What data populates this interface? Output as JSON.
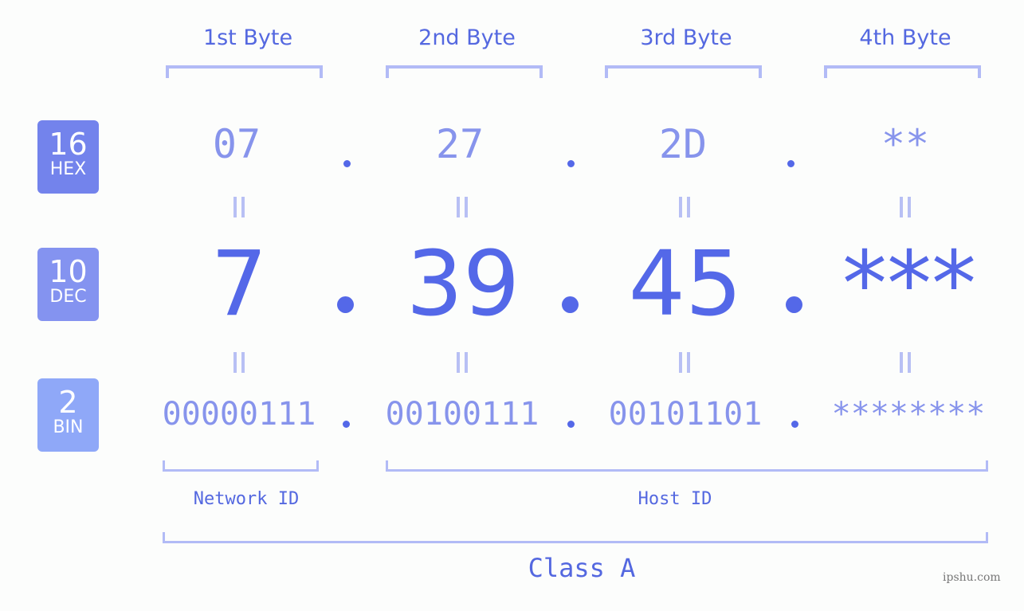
{
  "bytes": [
    {
      "header": "1st Byte",
      "hex": "07",
      "dec": "7",
      "bin": "00000111"
    },
    {
      "header": "2nd Byte",
      "hex": "27",
      "dec": "39",
      "bin": "00100111"
    },
    {
      "header": "3rd Byte",
      "hex": "2D",
      "dec": "45",
      "bin": "00101101"
    },
    {
      "header": "4th Byte",
      "hex": "**",
      "dec": "***",
      "bin": "********"
    }
  ],
  "badges": [
    {
      "number": "16",
      "label": "HEX",
      "color": "#7383ec"
    },
    {
      "number": "10",
      "label": "DEC",
      "color": "#8493f0"
    },
    {
      "number": "2",
      "label": "BIN",
      "color": "#8fa8f8"
    }
  ],
  "labels": {
    "network": "Network ID",
    "host": "Host ID",
    "class": "Class A"
  },
  "watermark": "ipshu.com",
  "colors": {
    "accent": "#5468e0",
    "light": "#8794ec",
    "bracket": "#b2bbf6"
  }
}
